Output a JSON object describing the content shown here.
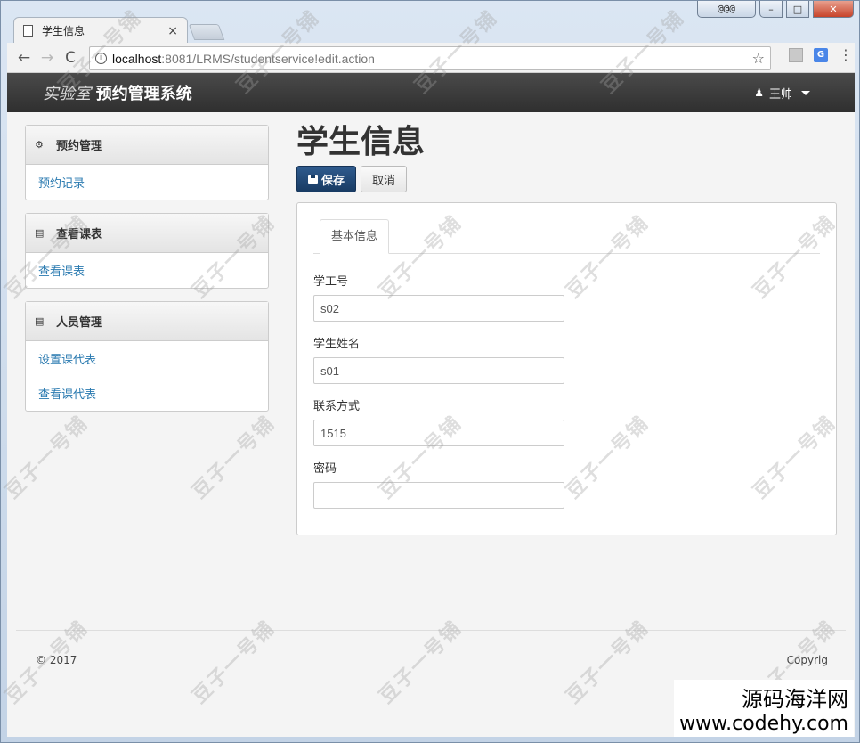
{
  "window": {
    "user_badge": "@@@",
    "minimize": "–",
    "maximize": "□",
    "close": "✕"
  },
  "browser": {
    "tab_title": "学生信息",
    "tab_close": "×",
    "back": "←",
    "forward": "→",
    "reload": "C",
    "url_host": "localhost",
    "url_path": ":8081/LRMS/studentservice!edit.action",
    "star": "☆",
    "translate_badge": "G",
    "menu": "⋮"
  },
  "navbar": {
    "brand_prefix": "实验室",
    "brand_main": "预约管理系统",
    "user_name": "王帅"
  },
  "sidebar": {
    "panels": [
      {
        "title": "预约管理",
        "icon": "dashboard-icon",
        "items": [
          "预约记录"
        ]
      },
      {
        "title": "查看课表",
        "icon": "briefcase-icon",
        "items": [
          "查看课表"
        ]
      },
      {
        "title": "人员管理",
        "icon": "briefcase-icon",
        "items": [
          "设置课代表",
          "查看课代表"
        ]
      }
    ]
  },
  "main": {
    "page_title": "学生信息",
    "save_label": "保存",
    "cancel_label": "取消",
    "tab_label": "基本信息",
    "fields": [
      {
        "label": "学工号",
        "value": "s02"
      },
      {
        "label": "学生姓名",
        "value": "s01"
      },
      {
        "label": "联系方式",
        "value": "1515"
      },
      {
        "label": "密码",
        "value": ""
      }
    ]
  },
  "footer": {
    "left": "© 2017",
    "right": "Copyrig"
  },
  "overlay": {
    "watermark_text": "豆子一号铺",
    "corner_cn": "源码海洋网",
    "corner_en": "www.codehy.com"
  }
}
